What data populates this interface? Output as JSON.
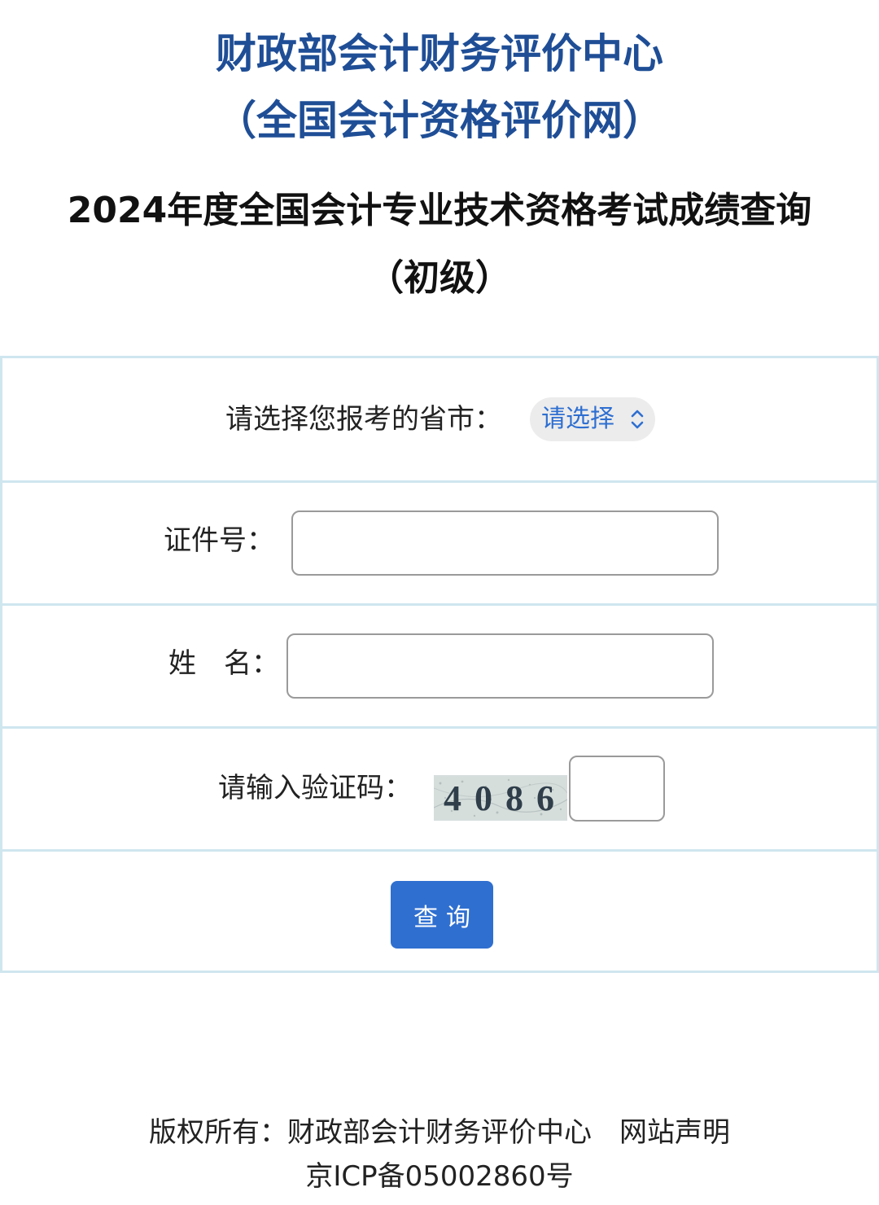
{
  "header": {
    "org_line1": "财政部会计财务评价中心",
    "org_line2": "（全国会计资格评价网）",
    "title_line1": "2024年度全国会计专业技术资格考试成绩查询",
    "title_line2": "（初级）"
  },
  "form": {
    "province_label": "请选择您报考的省市：",
    "province_select_value": "请选择",
    "id_label": "证件号：",
    "id_value": "",
    "name_label": "姓　名：",
    "name_value": "",
    "captcha_label": "请输入验证码：",
    "captcha_text": "4086",
    "captcha_value": "",
    "submit_label": "查询"
  },
  "footer": {
    "copyright_text": "版权所有：财政部会计财务评价中心",
    "statement_link": "网站声明",
    "icp_text": "京ICP备05002860号"
  },
  "colors": {
    "org_title": "#1f4e96",
    "accent_blue": "#2f6fd0",
    "form_border": "#cfe6ef",
    "select_bg": "#ececec"
  }
}
